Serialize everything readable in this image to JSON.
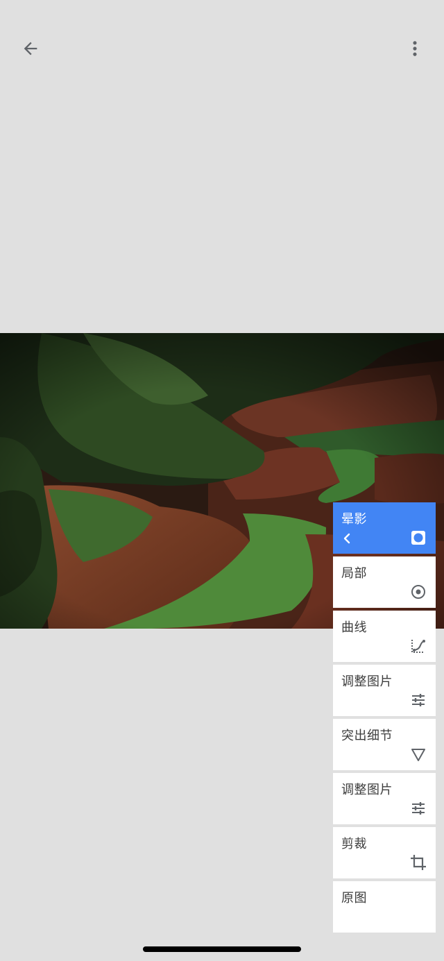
{
  "toolbar": {
    "back_icon": "arrow-left-icon",
    "more_icon": "more-vert-icon"
  },
  "tools": [
    {
      "label": "晕影",
      "icon": "vignette-icon",
      "active": true
    },
    {
      "label": "局部",
      "icon": "selective-icon"
    },
    {
      "label": "曲线",
      "icon": "curves-icon"
    },
    {
      "label": "调整图片",
      "icon": "tune-icon"
    },
    {
      "label": "突出细节",
      "icon": "details-icon"
    },
    {
      "label": "调整图片",
      "icon": "tune-icon"
    },
    {
      "label": "剪裁",
      "icon": "crop-icon"
    },
    {
      "label": "原图",
      "icon": ""
    }
  ],
  "colors": {
    "background": "#e0e0e0",
    "active_card": "#4285f4",
    "card": "#ffffff",
    "icon": "#5f6368"
  }
}
